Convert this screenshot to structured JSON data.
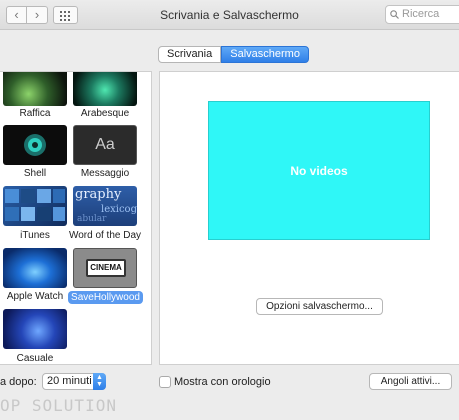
{
  "window": {
    "title": "Scrivania e Salvaschermo",
    "search_placeholder": "Ricerca",
    "back_glyph": "‹",
    "forward_glyph": "›"
  },
  "tabs": [
    {
      "label": "Scrivania",
      "active": false
    },
    {
      "label": "Salvaschermo",
      "active": true
    }
  ],
  "savers": [
    {
      "label": "Raffica",
      "icon": "raffica-thumbnail"
    },
    {
      "label": "Arabesque",
      "icon": "arabesque-thumbnail"
    },
    {
      "label": "Shell",
      "icon": "shell-thumbnail"
    },
    {
      "label": "Messaggio",
      "icon": "messaggio-thumbnail",
      "thumb_text": "Aa"
    },
    {
      "label": "iTunes",
      "icon": "itunes-thumbnail"
    },
    {
      "label": "Word of the Day",
      "icon": "word-of-the-day-thumbnail",
      "thumb_words": [
        "graphy",
        "lexicog",
        "abular"
      ]
    },
    {
      "label": "Apple Watch",
      "icon": "apple-watch-thumbnail"
    },
    {
      "label": "SaveHollywood",
      "icon": "cinema-thumbnail",
      "selected": true,
      "thumb_text": "CINEMA"
    },
    {
      "label": "Casuale",
      "icon": "casuale-thumbnail"
    }
  ],
  "preview": {
    "text": "No videos",
    "background": "#2ff7f7"
  },
  "options_button": "Opzioni salvaschermo...",
  "bottom": {
    "start_label": "a dopo:",
    "start_value": "20 minuti",
    "clock_label": "Mostra con orologio",
    "clock_checked": false,
    "hot_corners_button": "Angoli attivi..."
  },
  "watermark": "OP SOLUTION",
  "colors": {
    "accent": "#3b8bef",
    "selection": "#5a9af0"
  }
}
